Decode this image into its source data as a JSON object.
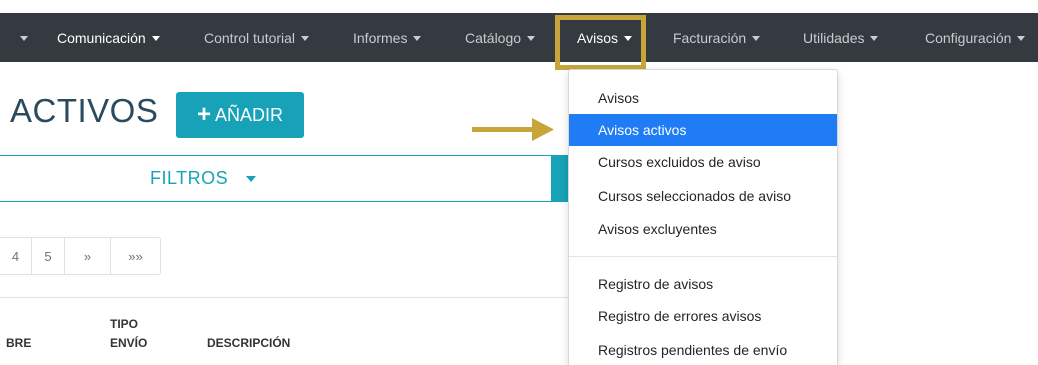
{
  "navbar": {
    "items": [
      {
        "label": "",
        "has_caret": true
      },
      {
        "label": "Comunicación",
        "has_caret": true
      },
      {
        "label": "Control tutorial",
        "has_caret": true
      },
      {
        "label": "Informes",
        "has_caret": true
      },
      {
        "label": "Catálogo",
        "has_caret": true
      },
      {
        "label": "Avisos",
        "has_caret": true,
        "active": true
      },
      {
        "label": "Facturación",
        "has_caret": true
      },
      {
        "label": "Utilidades",
        "has_caret": true
      },
      {
        "label": "Configuración",
        "has_caret": true
      }
    ]
  },
  "dropdown": {
    "items": [
      {
        "label": "Avisos"
      },
      {
        "label": "Avisos activos",
        "active": true
      },
      {
        "label": "Cursos excluidos de aviso"
      },
      {
        "label": "Cursos seleccionados de aviso"
      },
      {
        "label": "Avisos excluyentes"
      },
      {
        "label": "Registro de avisos"
      },
      {
        "label": "Registro de errores avisos"
      },
      {
        "label": "Registros pendientes de envío"
      }
    ]
  },
  "page": {
    "title": "ACTIVOS",
    "add_label": "AÑADIR",
    "add_icon": "plus-icon"
  },
  "filters": {
    "label": "FILTROS"
  },
  "pagination": {
    "pages": [
      "4",
      "5",
      "»",
      "»»"
    ]
  },
  "table": {
    "headers": {
      "name": "BRE",
      "tipo_line1": "TIPO",
      "tipo_line2": "ENVÍO",
      "descripcion": "DESCRIPCIÓN"
    }
  },
  "colors": {
    "navbar_bg": "#343a40",
    "highlight_box": "#c8a53a",
    "arrow": "#c8a53a",
    "accent_teal": "#17a2b8",
    "active_item": "#1f7cf5",
    "title_text": "#2b4a5e"
  }
}
